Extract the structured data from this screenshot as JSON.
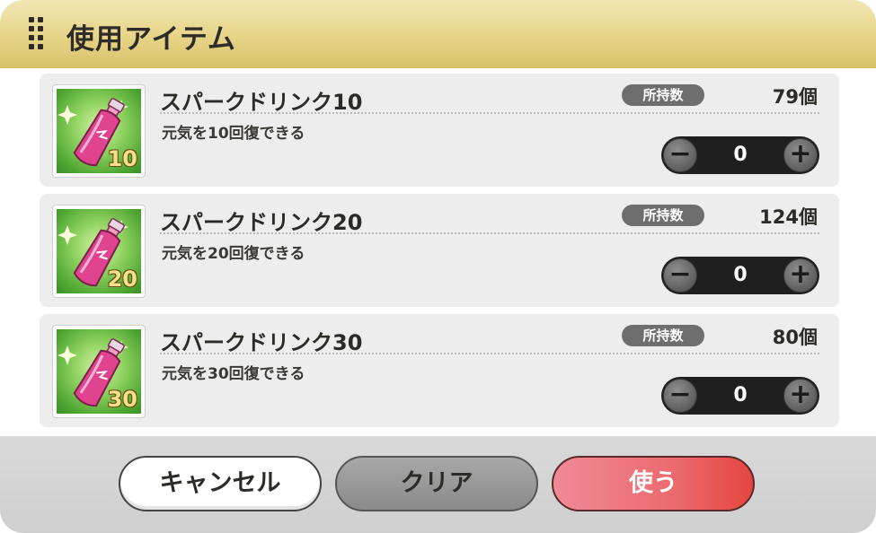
{
  "dialog": {
    "title": "使用アイテム"
  },
  "labels": {
    "owned": "所持数"
  },
  "items": [
    {
      "name": "スパークドリンク10",
      "description": "元気を10回復できる",
      "badge": "10",
      "owned": "79個",
      "quantity": "0"
    },
    {
      "name": "スパークドリンク20",
      "description": "元気を20回復できる",
      "badge": "20",
      "owned": "124個",
      "quantity": "0"
    },
    {
      "name": "スパークドリンク30",
      "description": "元気を30回復できる",
      "badge": "30",
      "owned": "80個",
      "quantity": "0"
    }
  ],
  "stepper": {
    "minus": "−",
    "plus": "+"
  },
  "footer": {
    "cancel": "キャンセル",
    "clear": "クリア",
    "use": "使う"
  },
  "colors": {
    "header": "#e6d487",
    "use_button": "#ec6a70",
    "clear_button": "#8a8a8a",
    "item_bg": "#ededed"
  },
  "icons": {
    "grip": "drag-handle-icon",
    "item": "pink-bottle-drink-icon"
  }
}
